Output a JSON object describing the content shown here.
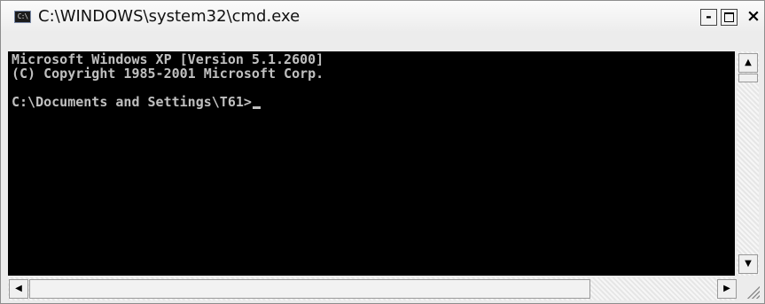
{
  "window": {
    "title": "C:\\WINDOWS\\system32\\cmd.exe",
    "icon": "cmd-icon",
    "icon_text": "C:\\",
    "controls": {
      "minimize": "-",
      "maximize": "□",
      "close": "×"
    }
  },
  "console": {
    "background": "#000000",
    "foreground": "#c0c0c0",
    "lines": [
      "Microsoft Windows XP [Version 5.1.2600]",
      "(C) Copyright 1985-2001 Microsoft Corp.",
      "",
      "C:\\Documents and Settings\\T61>"
    ]
  },
  "scrollbars": {
    "up_arrow": "▲",
    "down_arrow": "▼",
    "left_arrow": "◀",
    "right_arrow": "▶"
  }
}
